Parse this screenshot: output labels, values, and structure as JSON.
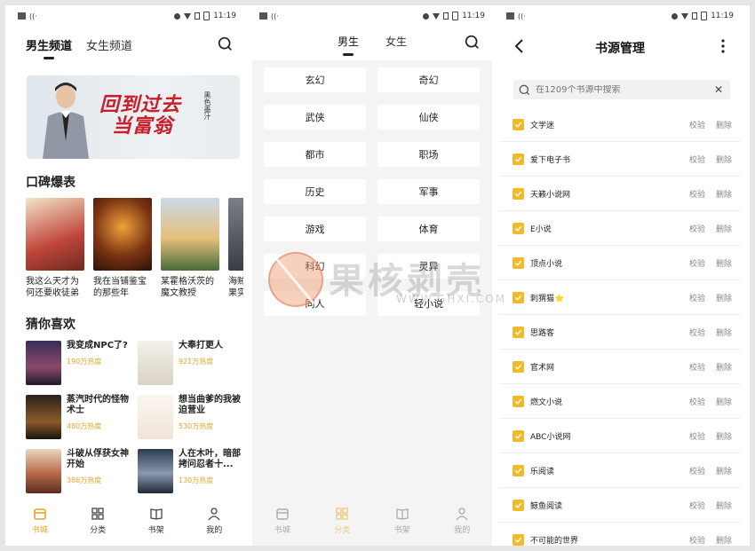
{
  "status": {
    "time": "11:19"
  },
  "panel1": {
    "channels": [
      "男生频道",
      "女生频道"
    ],
    "banner": {
      "title_line1": "回到过去",
      "title_line2": "当富翁",
      "author": "黑色墨汁"
    },
    "rec_title": "口碑爆表",
    "rec_books": [
      {
        "name": "我这么天才为何还要收徒弟"
      },
      {
        "name": "我在当铺鉴宝的那些年"
      },
      {
        "name": "某霍格沃茨的魔文教授"
      },
      {
        "name": "海贼果实"
      }
    ],
    "like_title": "猜你喜欢",
    "like_books": [
      {
        "name": "我变成NPC了?",
        "hot": "190万热度"
      },
      {
        "name": "大奉打更人",
        "hot": "921万热度"
      },
      {
        "name": "蒸汽时代的怪物术士",
        "hot": "480万热度"
      },
      {
        "name": "想当曲爹的我被迫营业",
        "hot": "530万热度"
      },
      {
        "name": "斗破从俘获女神开始",
        "hot": "386万热度"
      },
      {
        "name": "人在木叶，暗部拷问忍者十...",
        "hot": "130万热度"
      }
    ],
    "tabs": [
      "书城",
      "分类",
      "书架",
      "我的"
    ]
  },
  "panel2": {
    "tabs": [
      "男生",
      "女生"
    ],
    "categories": [
      "玄幻",
      "奇幻",
      "武侠",
      "仙侠",
      "都市",
      "职场",
      "历史",
      "军事",
      "游戏",
      "体育",
      "科幻",
      "灵异",
      "同人",
      "轻小说"
    ],
    "tabs_bottom": [
      "书城",
      "分类",
      "书架",
      "我的"
    ]
  },
  "watermark": {
    "text": "果核剥壳",
    "url": "WWW.GHXI.COM"
  },
  "panel3": {
    "title": "书源管理",
    "search_placeholder": "在1209个书源中搜索",
    "verify_label": "校验",
    "delete_label": "删除",
    "sources": [
      "文学迷",
      "爱下电子书",
      "天籁小说网",
      "E小说",
      "顶点小说",
      "刺猬猫⭐",
      "思路客",
      "官术网",
      "燃文小说",
      "ABC小说网",
      "乐阅读",
      "鲸鱼阅读",
      "不可能的世界"
    ]
  }
}
